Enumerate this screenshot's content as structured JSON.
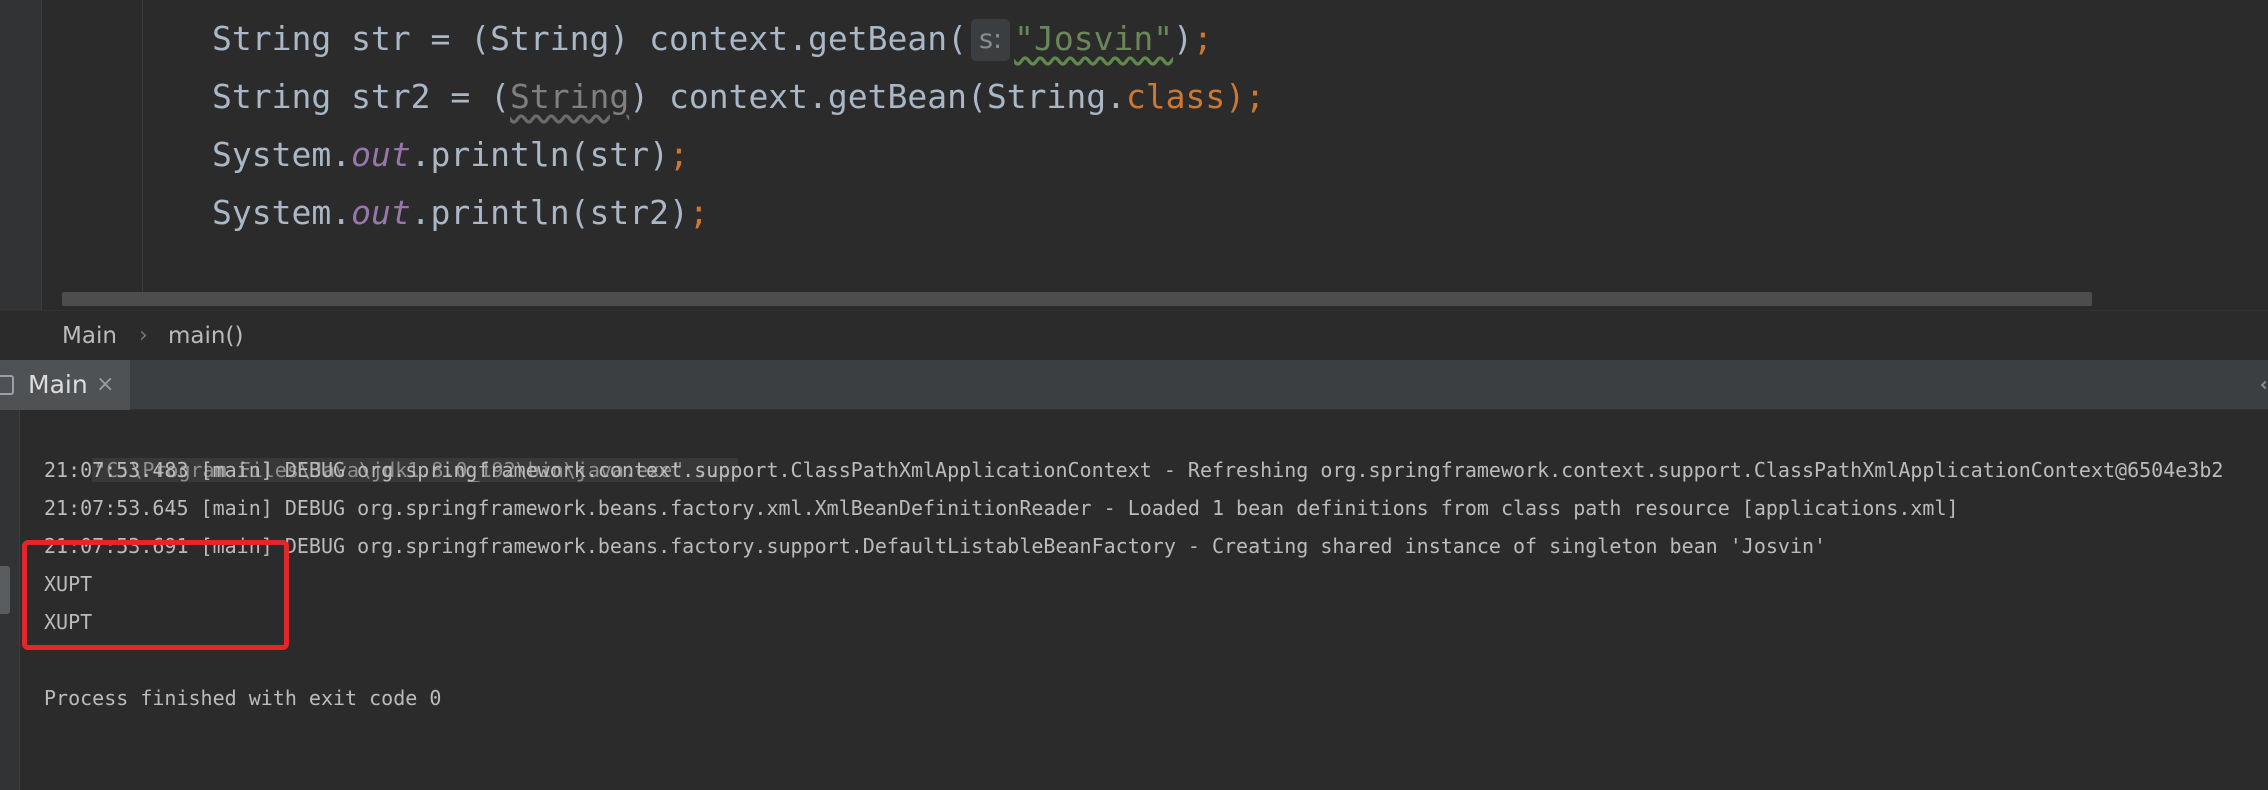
{
  "editor": {
    "lines": [
      [
        {
          "t": "String str = (String) context.getBean(",
          "c": "plain"
        },
        {
          "t": "s:",
          "c": "hint"
        },
        {
          "t": "\"Josvin\"",
          "c": "str"
        },
        {
          "t": ")",
          "c": "plain"
        },
        {
          "t": ";",
          "c": "kw"
        }
      ],
      [
        {
          "t": "String str2 = (",
          "c": "plain"
        },
        {
          "t": "String",
          "c": "gray"
        },
        {
          "t": ") context.getBean(String.",
          "c": "plain"
        },
        {
          "t": "class",
          "c": "kw"
        },
        {
          "t": ");",
          "c": "kw"
        }
      ],
      [
        {
          "t": "System.",
          "c": "plain"
        },
        {
          "t": "out",
          "c": "fld"
        },
        {
          "t": ".println(str)",
          "c": "plain"
        },
        {
          "t": ";",
          "c": "kw"
        }
      ],
      [
        {
          "t": "System.",
          "c": "plain"
        },
        {
          "t": "out",
          "c": "fld"
        },
        {
          "t": ".println(str2)",
          "c": "plain"
        },
        {
          "t": ";",
          "c": "kw"
        }
      ]
    ]
  },
  "breadcrumb": {
    "class_name": "Main",
    "separator": "›",
    "method_name": "main()"
  },
  "run_tab": {
    "label": "Main",
    "close": "×"
  },
  "console": {
    "command": "\"C:\\Program Files\\Java\\jdk1.8.0_192\\bin\\java.exe\" ...",
    "lines": [
      "21:07:53.483 [main] DEBUG org.springframework.context.support.ClassPathXmlApplicationContext - Refreshing org.springframework.context.support.ClassPathXmlApplicationContext@6504e3b2",
      "21:07:53.645 [main] DEBUG org.springframework.beans.factory.xml.XmlBeanDefinitionReader - Loaded 1 bean definitions from class path resource [applications.xml]",
      "21:07:53.691 [main] DEBUG org.springframework.beans.factory.support.DefaultListableBeanFactory - Creating shared instance of singleton bean 'Josvin'",
      "XUPT",
      "XUPT"
    ],
    "exit_message": "Process finished with exit code 0"
  },
  "colors": {
    "highlight_box": "#e3262b",
    "keyword": "#cc7832",
    "string": "#6a8759",
    "field": "#9876aa"
  }
}
